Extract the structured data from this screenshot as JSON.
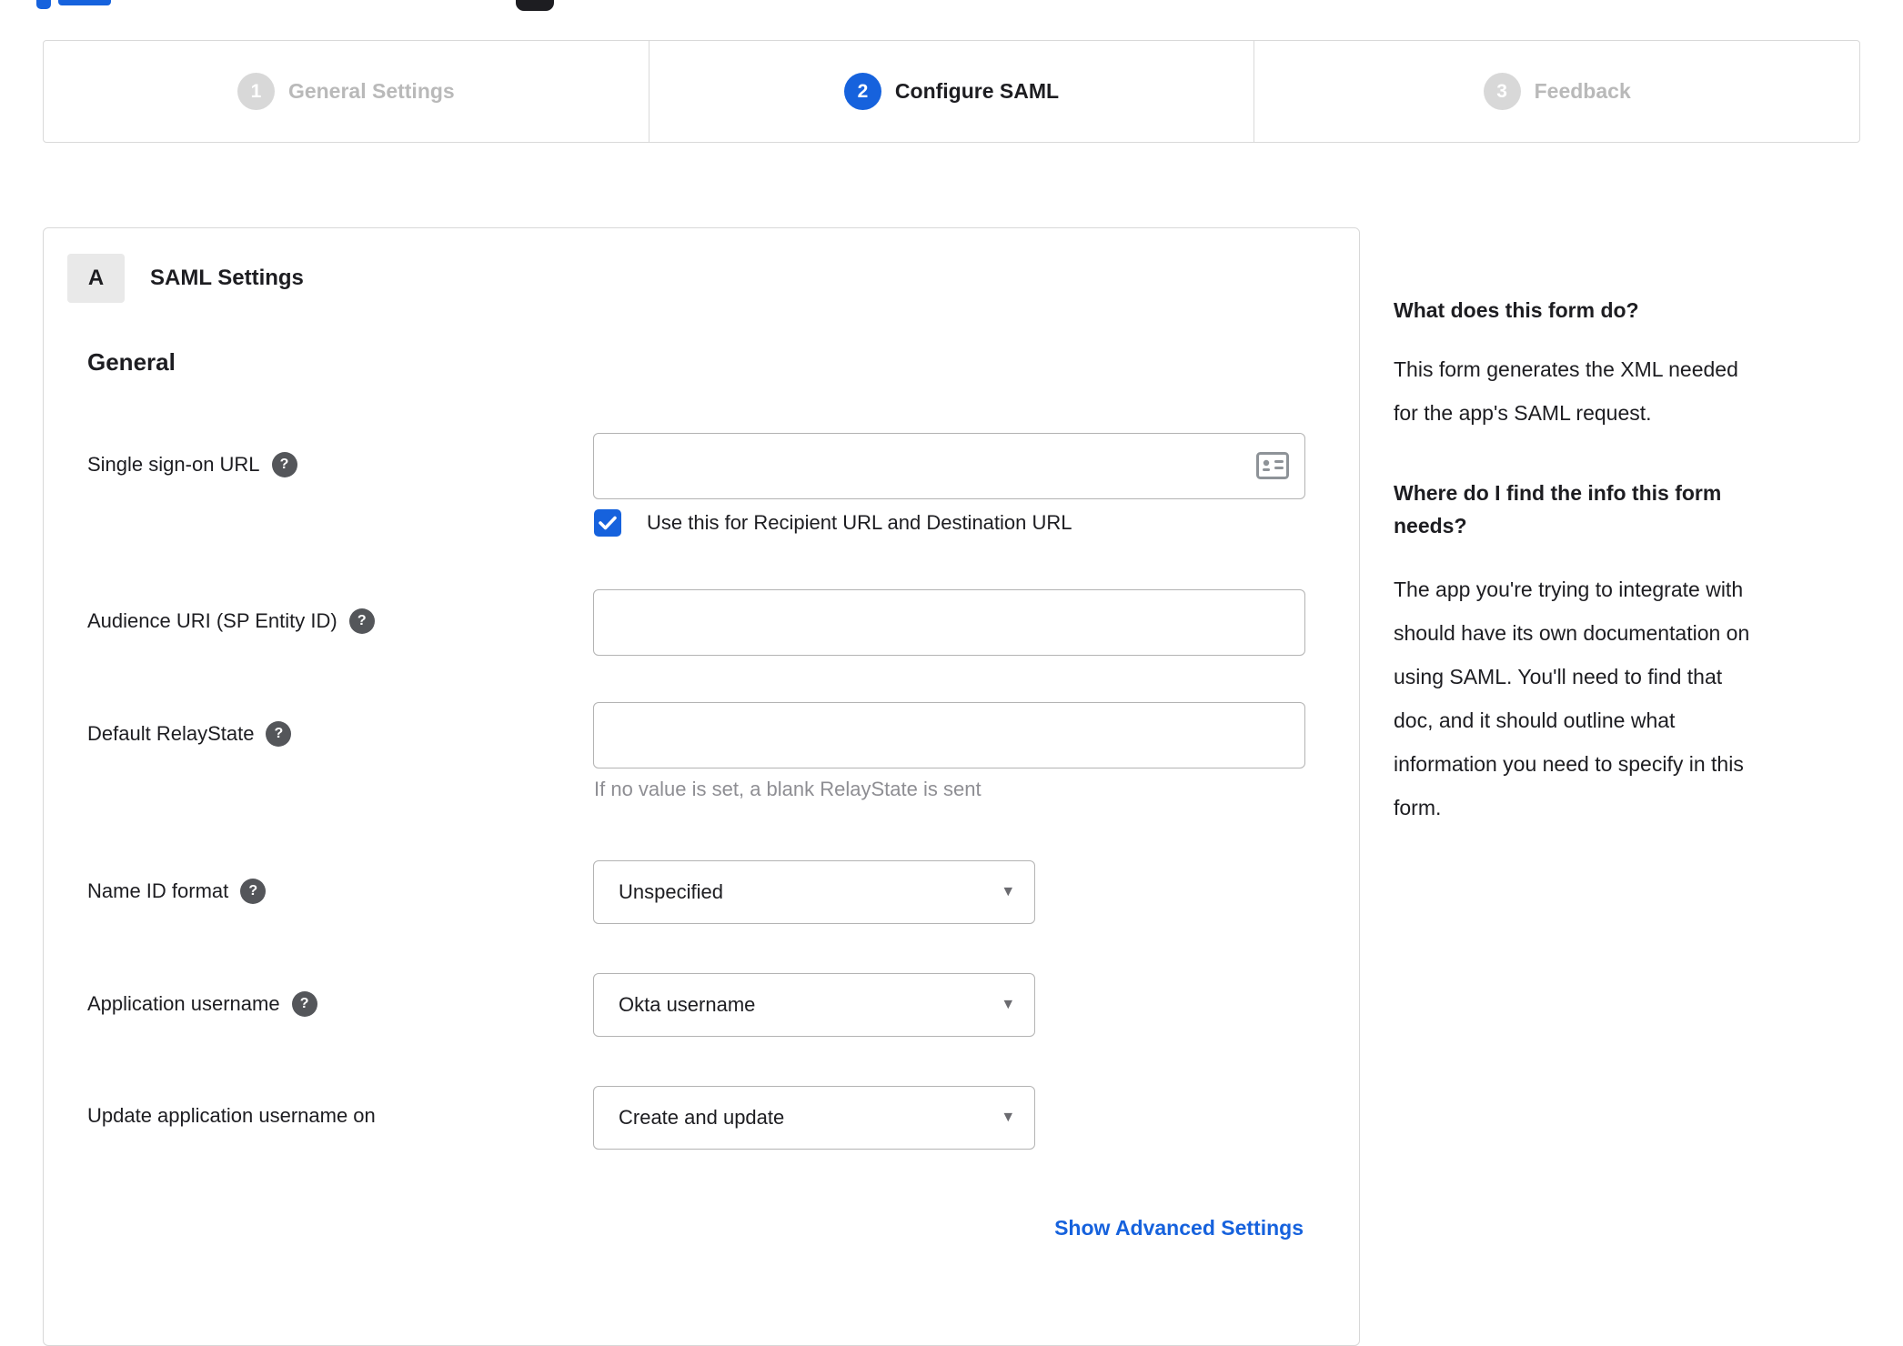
{
  "colors": {
    "accent_blue": "#1662dd",
    "link_blue": "#1662dd",
    "inactive_gray": "#d8d8d8",
    "border_gray": "#d8d8d8"
  },
  "icons": {
    "help": "?",
    "dropdown_arrow": "▾"
  },
  "stepper": {
    "steps": [
      {
        "number": "1",
        "label": "General Settings"
      },
      {
        "number": "2",
        "label": "Configure SAML"
      },
      {
        "number": "3",
        "label": "Feedback"
      }
    ]
  },
  "panel": {
    "badge": "A",
    "title": "SAML Settings",
    "general_heading": "General",
    "sso": {
      "label": "Single sign-on URL",
      "value": "",
      "checkbox_label": "Use this for Recipient URL and Destination URL",
      "checkbox_checked": true
    },
    "audience": {
      "label": "Audience URI (SP Entity ID)",
      "value": ""
    },
    "relay": {
      "label": "Default RelayState",
      "value": "",
      "hint": "If no value is set, a blank RelayState is sent"
    },
    "name_id": {
      "label": "Name ID format",
      "value": "Unspecified"
    },
    "app_username": {
      "label": "Application username",
      "value": "Okta username"
    },
    "update_username": {
      "label": "Update application username on",
      "value": "Create and update"
    },
    "advanced_link": "Show Advanced Settings"
  },
  "sidebar": {
    "q1": "What does this form do?",
    "a1_lines": [
      "This form generates the XML needed",
      "for the app's SAML request."
    ],
    "q2_lines": [
      "Where do I find the info this form",
      "needs?"
    ],
    "a2_lines": [
      "The app you're trying to integrate with",
      "should have its own documentation on",
      "using SAML. You'll need to find that",
      "doc, and it should outline what",
      "information you need to specify in this",
      "form."
    ]
  }
}
